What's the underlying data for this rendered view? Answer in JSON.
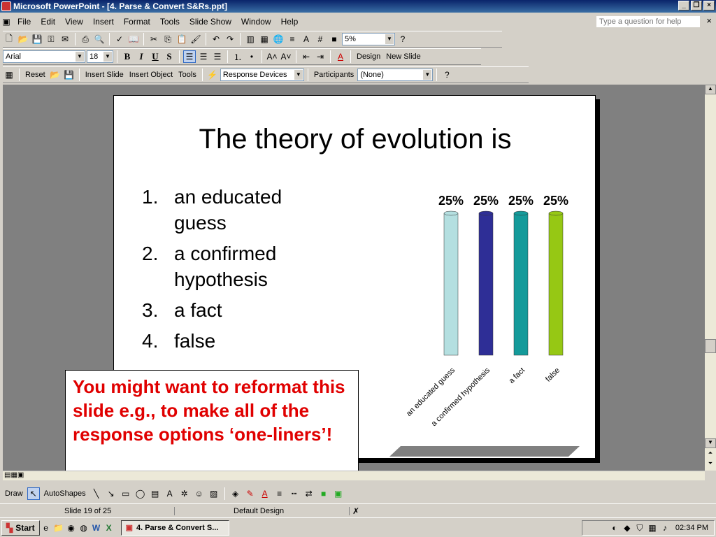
{
  "window": {
    "title": "Microsoft PowerPoint - [4. Parse & Convert S&Rs.ppt]"
  },
  "menu": [
    "File",
    "Edit",
    "View",
    "Insert",
    "Format",
    "Tools",
    "Slide Show",
    "Window",
    "Help"
  ],
  "help_placeholder": "Type a question for help",
  "toolbar1": {
    "zoom": "5%"
  },
  "toolbar2": {
    "font": "Arial",
    "size": "18",
    "bold": "B",
    "italic": "I",
    "underline": "U",
    "shadow": "S",
    "design": "Design",
    "new_slide": "New Slide"
  },
  "toolbar3": {
    "reset": "Reset",
    "insert_slide": "Insert Slide",
    "insert_object": "Insert Object",
    "tools": "Tools",
    "response_devices": "Response Devices",
    "participants": "Participants",
    "none": "(None)"
  },
  "slide": {
    "title": "The theory of evolution is",
    "options": [
      {
        "num": "1.",
        "text": "an educated guess"
      },
      {
        "num": "2.",
        "text": "a confirmed hypothesis"
      },
      {
        "num": "3.",
        "text": "a fact"
      },
      {
        "num": "4.",
        "text": "false"
      }
    ],
    "note": "You might want to reformat this slide e.g., to make all of the response options ‘one-liners’!"
  },
  "chart_data": {
    "type": "bar",
    "categories": [
      "an educated guess",
      "a confirmed hypothesis",
      "a fact",
      "false"
    ],
    "values": [
      25,
      25,
      25,
      25
    ],
    "value_labels": [
      "25%",
      "25%",
      "25%",
      "25%"
    ],
    "colors": [
      "#b4dfe0",
      "#2e2e96",
      "#149a9a",
      "#96c814"
    ],
    "title": "",
    "xlabel": "",
    "ylabel": ""
  },
  "drawbar": {
    "draw": "Draw",
    "autoshapes": "AutoShapes"
  },
  "status": {
    "slide": "Slide 19 of 25",
    "design": "Default Design"
  },
  "taskbar": {
    "start": "Start",
    "item": "4. Parse & Convert S...",
    "clock": "02:34 PM"
  }
}
